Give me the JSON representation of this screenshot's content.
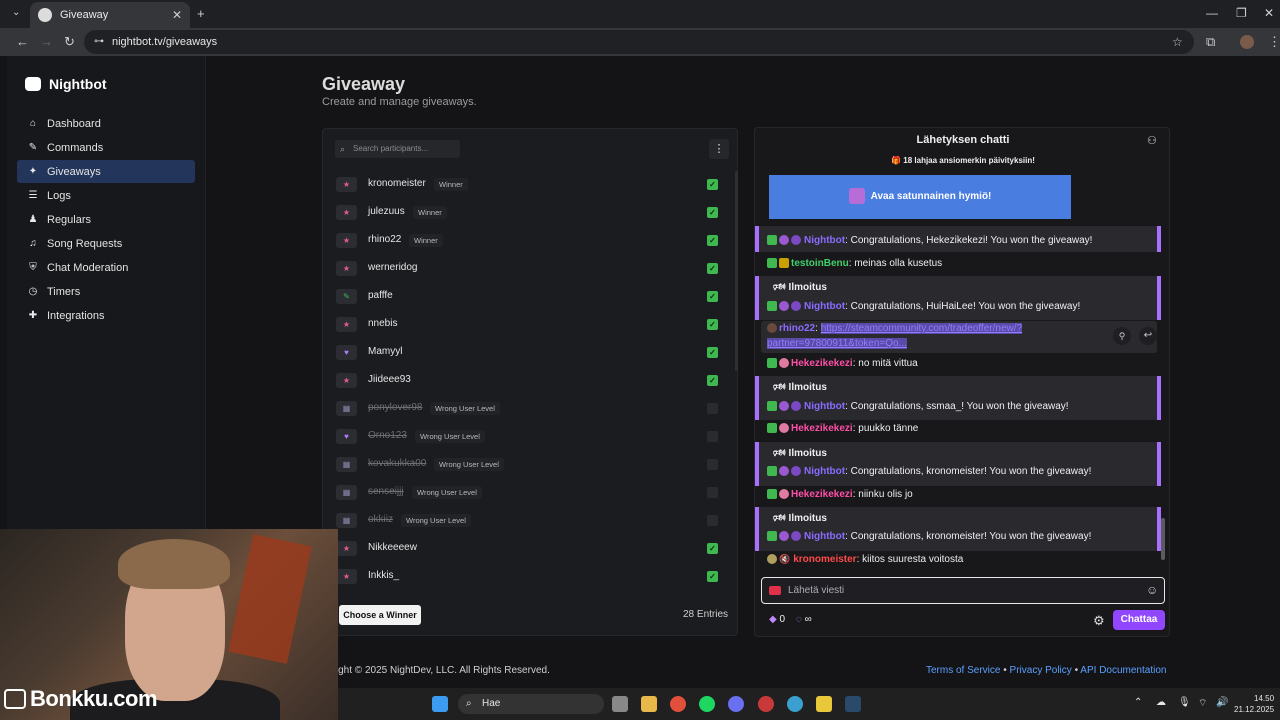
{
  "browser": {
    "tab_title": "Giveaway",
    "url": "nightbot.tv/giveaways"
  },
  "sidebar": {
    "brand": "Nightbot",
    "items": [
      {
        "label": "Dashboard",
        "icon": "home-icon"
      },
      {
        "label": "Commands",
        "icon": "wand-icon"
      },
      {
        "label": "Giveaways",
        "icon": "giveaway-icon",
        "active": true
      },
      {
        "label": "Logs",
        "icon": "list-icon"
      },
      {
        "label": "Regulars",
        "icon": "regulars-icon"
      },
      {
        "label": "Song Requests",
        "icon": "headphones-icon"
      },
      {
        "label": "Chat Moderation",
        "icon": "shield-icon"
      },
      {
        "label": "Timers",
        "icon": "clock-icon"
      },
      {
        "label": "Integrations",
        "icon": "puzzle-icon"
      }
    ]
  },
  "main": {
    "title": "Giveaway",
    "subtitle": "Create and manage giveaways."
  },
  "participants": {
    "search_placeholder": "Search participants...",
    "rows": [
      {
        "name": "kronomeister",
        "tag": "Winner",
        "checked": true,
        "struck": false
      },
      {
        "name": "julezuus",
        "tag": "Winner",
        "checked": true,
        "struck": false
      },
      {
        "name": "rhino22",
        "tag": "Winner",
        "checked": true,
        "struck": false
      },
      {
        "name": "werneridog",
        "tag": "",
        "checked": true,
        "struck": false
      },
      {
        "name": "pafffe",
        "tag": "",
        "checked": true,
        "struck": false
      },
      {
        "name": "nnebis",
        "tag": "",
        "checked": true,
        "struck": false
      },
      {
        "name": "Mamyyl",
        "tag": "",
        "checked": true,
        "struck": false
      },
      {
        "name": "Jiideee93",
        "tag": "",
        "checked": true,
        "struck": false
      },
      {
        "name": "ponylover98",
        "tag": "Wrong User Level",
        "checked": false,
        "struck": true
      },
      {
        "name": "Orno123",
        "tag": "Wrong User Level",
        "checked": false,
        "struck": true
      },
      {
        "name": "kovakukka00",
        "tag": "Wrong User Level",
        "checked": false,
        "struck": true
      },
      {
        "name": "senseijjj",
        "tag": "Wrong User Level",
        "checked": false,
        "struck": true
      },
      {
        "name": "okkiiz",
        "tag": "Wrong User Level",
        "checked": false,
        "struck": true
      },
      {
        "name": "Nikkeeeew",
        "tag": "",
        "checked": true,
        "struck": false
      },
      {
        "name": "Inkkis_",
        "tag": "",
        "checked": true,
        "struck": false
      }
    ],
    "choose_winner_label": "Choose a Winner",
    "entries_label": "28 Entries"
  },
  "chat": {
    "header": "Lähetyksen chatti",
    "gift_banner": "18 lahjaa ansiomerkin päivityksiin!",
    "emote_button": "Avaa satunnainen hymiö!",
    "notice_label": "Ilmoitus",
    "messages": [
      {
        "user": "Nightbot",
        "color": "#8a6cff",
        "text": ": Congratulations, Hekezikekezi! You won the giveaway!"
      },
      {
        "user": "testoinBenu",
        "color": "#3fd06a",
        "text": ": meinas olla kusetus"
      },
      {
        "user": "Nightbot",
        "color": "#8a6cff",
        "text": ": Congratulations, HuiHaiLee! You won the giveaway!"
      },
      {
        "user": "rhino22",
        "color": "#8a6cff",
        "text": ": ",
        "link1": "https://steamcommunity.com/tradeoffer/new/?",
        "link2": "partner=97800911&token=Qo..."
      },
      {
        "user": "Hekezikekezi",
        "color": "#ff4fa8",
        "text": ": no mitä vittua"
      },
      {
        "user": "Nightbot",
        "color": "#8a6cff",
        "text": ": Congratulations, ssmaa_! You won the giveaway!"
      },
      {
        "user": "Hekezikekezi",
        "color": "#ff4fa8",
        "text": ": puukko tänne"
      },
      {
        "user": "Nightbot",
        "color": "#8a6cff",
        "text": ": Congratulations, kronomeister! You won the giveaway!"
      },
      {
        "user": "Hekezikekezi",
        "color": "#ff4fa8",
        "text": ": niinku olis jo"
      },
      {
        "user": "Nightbot",
        "color": "#8a6cff",
        "text": ": Congratulations, kronomeister! You won the giveaway!"
      },
      {
        "user": "kronomeister",
        "color": "#ff4a4a",
        "text": ": kiitos suuresta voitosta"
      }
    ],
    "input_placeholder": "Lähetä viesti",
    "bits_count": "0",
    "points_value": "∞",
    "send_label": "Chattaa"
  },
  "footer": {
    "copyright": "pyright © 2025 NightDev, LLC. All Rights Reserved.",
    "links": [
      "Terms of Service",
      "Privacy Policy",
      "API Documentation"
    ]
  },
  "overlay": {
    "watermark": "Bonkku.com"
  },
  "taskbar": {
    "search_label": "Hae",
    "time": "14.50",
    "date": "21.12.2025"
  }
}
